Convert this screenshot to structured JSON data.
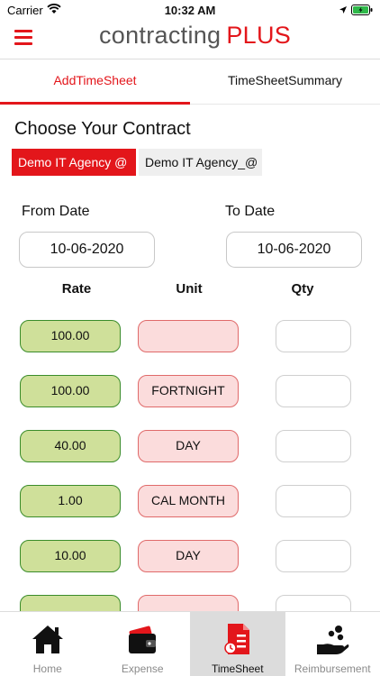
{
  "status_bar": {
    "carrier": "Carrier",
    "time": "10:32 AM"
  },
  "header": {
    "logo_main": "contracting",
    "logo_accent": "PLUS",
    "brand_color": "#e3161b"
  },
  "tabs": [
    {
      "label": "AddTimeSheet",
      "active": true
    },
    {
      "label": "TimeSheetSummary",
      "active": false
    }
  ],
  "form": {
    "contract_title": "Choose Your Contract",
    "contracts": [
      "Demo IT Agency @",
      "Demo IT Agency_@"
    ],
    "from_date_label": "From Date",
    "from_date_value": "10-06-2020",
    "to_date_label": "To Date",
    "to_date_value": "10-06-2020",
    "columns": {
      "rate": "Rate",
      "unit": "Unit",
      "qty": "Qty"
    },
    "rows": [
      {
        "rate": "100.00",
        "unit": "",
        "qty": ""
      },
      {
        "rate": "100.00",
        "unit": "FORTNIGHT",
        "qty": ""
      },
      {
        "rate": "40.00",
        "unit": "DAY",
        "qty": ""
      },
      {
        "rate": "1.00",
        "unit": "CAL MONTH",
        "qty": ""
      },
      {
        "rate": "10.00",
        "unit": "DAY",
        "qty": ""
      },
      {
        "rate": "",
        "unit": "",
        "qty": ""
      }
    ]
  },
  "bottom_nav": [
    {
      "label": "Home",
      "icon": "home-icon",
      "active": false
    },
    {
      "label": "Expense",
      "icon": "wallet-icon",
      "active": false
    },
    {
      "label": "TimeSheet",
      "icon": "timesheet-icon",
      "active": true
    },
    {
      "label": "Reimbursement",
      "icon": "reimbursement-icon",
      "active": false
    }
  ]
}
